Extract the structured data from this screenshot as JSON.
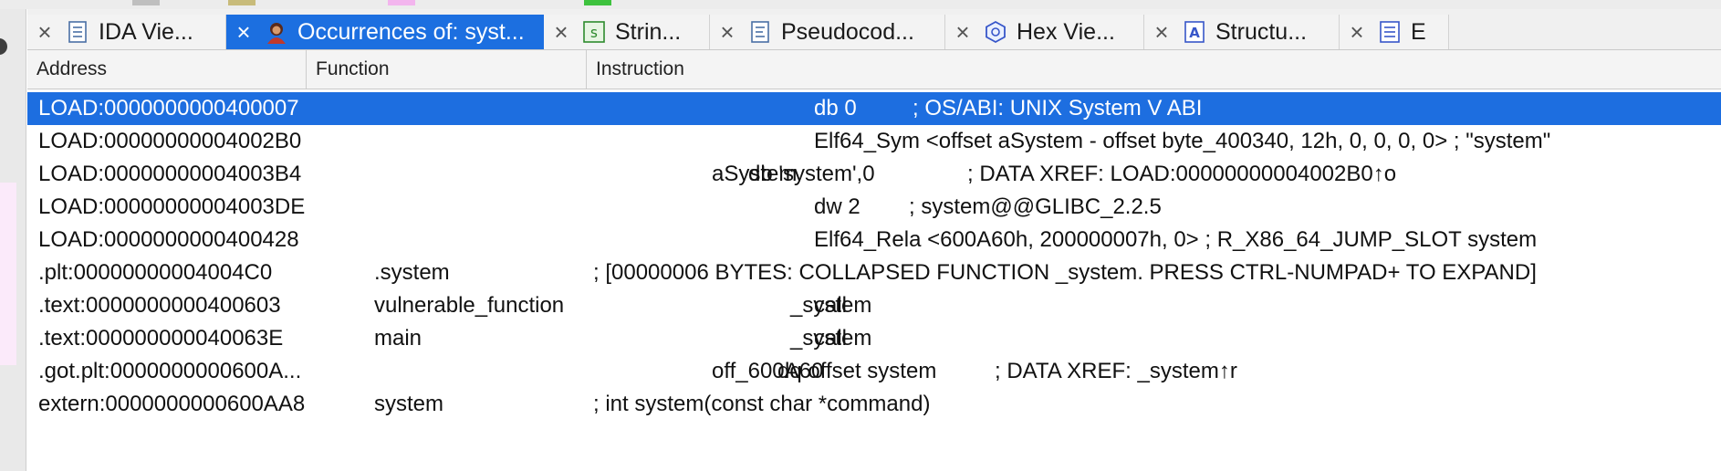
{
  "legend": {
    "colors": [
      "#bfbfbf",
      "#c8bb7a",
      "#f3b5ee",
      "#3ec23e"
    ]
  },
  "tabs": [
    {
      "label": "IDA Vie...",
      "icon": "listing-icon",
      "active": false
    },
    {
      "label": "Occurrences of: syst...",
      "icon": "search-result-avatar-icon",
      "active": true
    },
    {
      "label": "Strin...",
      "icon": "strings-icon",
      "active": false
    },
    {
      "label": "Pseudocod...",
      "icon": "pseudocode-icon",
      "active": false
    },
    {
      "label": "Hex Vie...",
      "icon": "hex-view-icon",
      "active": false
    },
    {
      "label": "Structu...",
      "icon": "structures-icon",
      "active": false
    },
    {
      "label": "E",
      "icon": "enums-icon",
      "active": false
    }
  ],
  "table": {
    "columns": [
      "Address",
      "Function",
      "Instruction"
    ],
    "rows": [
      {
        "address": "LOAD:0000000000400007",
        "function": "",
        "label": "",
        "mnemonic": "db 0",
        "operands": "",
        "comment": "; OS/ABI: UNIX System V ABI",
        "selected": true
      },
      {
        "address": "LOAD:00000000004002B0",
        "function": "",
        "label": "",
        "mnemonic": "Elf64_Sym <offset aSystem - offset byte_400340, 12h, 0, 0, 0, 0> ; \"system\"",
        "operands": "",
        "comment": "",
        "selected": false
      },
      {
        "address": "LOAD:00000000004003B4",
        "function": "",
        "label": "aSystem",
        "mnemonic": "db 'system',0",
        "operands": "",
        "comment": "; DATA XREF: LOAD:00000000004002B0↑o",
        "selected": false
      },
      {
        "address": "LOAD:00000000004003DE",
        "function": "",
        "label": "",
        "mnemonic": "dw 2",
        "operands": "",
        "comment": "; system@@GLIBC_2.2.5",
        "selected": false
      },
      {
        "address": "LOAD:0000000000400428",
        "function": "",
        "label": "",
        "mnemonic": "Elf64_Rela <600A60h, 200000007h, 0> ; R_X86_64_JUMP_SLOT system",
        "operands": "",
        "comment": "",
        "selected": false
      },
      {
        "address": ".plt:00000000004004C0",
        "function": ".system",
        "label": "",
        "mnemonic": "",
        "operands": "",
        "comment": "; [00000006 BYTES: COLLAPSED FUNCTION _system. PRESS CTRL-NUMPAD+ TO EXPAND]",
        "selected": false
      },
      {
        "address": ".text:0000000000400603",
        "function": "vulnerable_function",
        "label": "",
        "mnemonic": "call",
        "operands": "_system",
        "comment": "",
        "selected": false
      },
      {
        "address": ".text:000000000040063E",
        "function": "main",
        "label": "",
        "mnemonic": "call",
        "operands": "_system",
        "comment": "",
        "selected": false
      },
      {
        "address": ".got.plt:0000000000600A...",
        "function": "",
        "label": "off_600A60",
        "mnemonic": "dq offset system",
        "operands": "",
        "comment": "; DATA XREF: _system↑r",
        "selected": false
      },
      {
        "address": "extern:0000000000600AA8",
        "function": "system",
        "label": "",
        "mnemonic": "",
        "operands": "",
        "comment": "; int system(const char *command)",
        "selected": false
      }
    ]
  }
}
